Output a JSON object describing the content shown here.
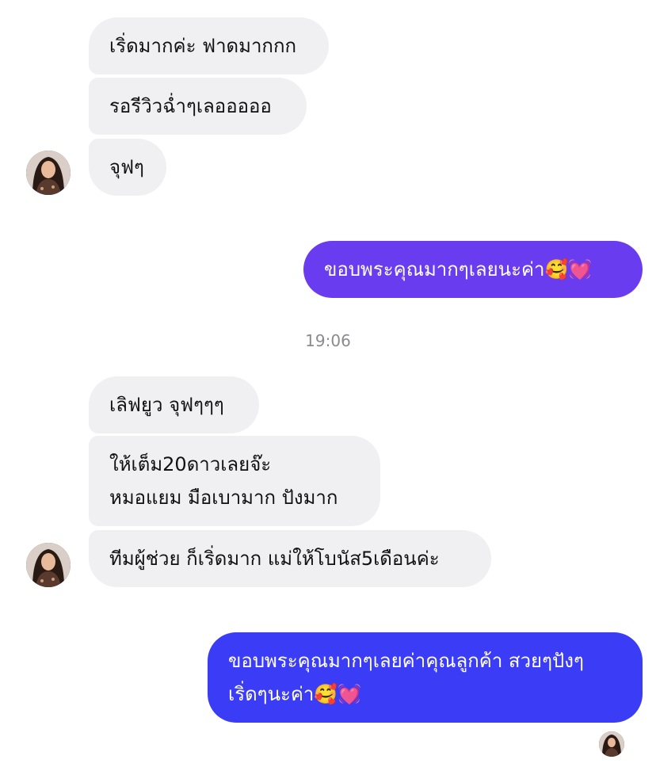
{
  "colors": {
    "incoming_bg": "#f0f0f3",
    "outgoing_purple": "#6a3cf0",
    "outgoing_blue": "#3b3cf5",
    "text": "#111111",
    "timestamp": "#8a8a8f"
  },
  "messages": {
    "m1": "เริ่ดมากค่ะ ฟาดมากกก",
    "m2": "รอรีวิวฉ่ำๆเลอออออ",
    "m3": "จุฟๆ",
    "m4": "ขอบพระคุณมากๆเลยนะค่า🥰💓",
    "m5": "เลิฟยูว จุฟๆๆๆ",
    "m6_line1": "ให้เต็ม20ดาวเลยจ๊ะ",
    "m6_line2": "หมอแยม มือเบามาก ปังมาก",
    "m7": "ทีมผู้ช่วย ก็เริ่ดมาก แม่ให้โบนัส5เดือนค่ะ",
    "m8_line1": "ขอบพระคุณมากๆเลยค่าคุณลูกค้า สวยๆปังๆ",
    "m8_line2": "เริ่ดๆนะค่า🥰💓"
  },
  "timestamp": "19:06",
  "icons": {
    "contact_avatar": "contact-avatar",
    "seen_avatar": "seen-avatar"
  }
}
